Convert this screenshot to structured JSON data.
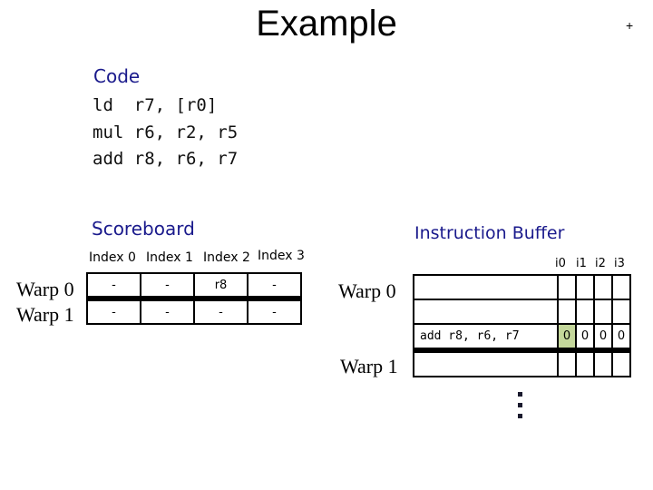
{
  "title": "Example",
  "corner_mark": "+",
  "code": {
    "heading": "Code",
    "lines": [
      "ld  r7, [r0]",
      "mul r6, r2, r5",
      "add r8, r6, r7"
    ]
  },
  "scoreboard": {
    "heading": "Scoreboard",
    "columns": [
      "Index 0",
      "Index 1",
      "Index 2",
      "Index 3"
    ],
    "rows": [
      {
        "label": "Warp 0",
        "cells": [
          "-",
          "-",
          "r8",
          "-"
        ]
      },
      {
        "label": "Warp 1",
        "cells": [
          "-",
          "-",
          "-",
          "-"
        ]
      }
    ]
  },
  "instruction_buffer": {
    "heading": "Instruction Buffer",
    "bit_columns": [
      "i0",
      "i1",
      "i2",
      "i3"
    ],
    "warp_labels": [
      "Warp 0",
      "Warp 1"
    ],
    "rows": [
      {
        "instruction": "",
        "bits": [
          "",
          "",
          "",
          ""
        ]
      },
      {
        "instruction": "",
        "bits": [
          "",
          "",
          "",
          ""
        ]
      },
      {
        "instruction": "add r8, r6, r7",
        "bits": [
          "0",
          "0",
          "0",
          "0"
        ],
        "highlight_bit": 0
      },
      {
        "instruction": "",
        "bits": [
          "",
          "",
          "",
          ""
        ]
      }
    ],
    "highlight_color": "#c4d79b"
  },
  "ellipsis": "vertical-ellipsis"
}
